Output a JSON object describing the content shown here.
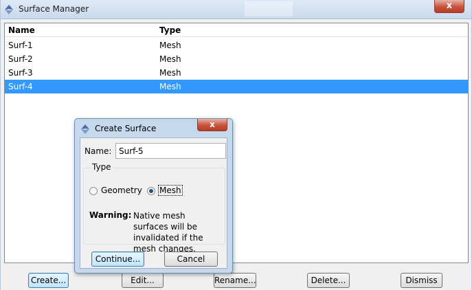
{
  "window": {
    "title": "Surface Manager",
    "close_glyph": "x"
  },
  "list": {
    "columns": [
      "Name",
      "Type"
    ],
    "rows": [
      {
        "name": "Surf-1",
        "type": "Mesh"
      },
      {
        "name": "Surf-2",
        "type": "Mesh"
      },
      {
        "name": "Surf-3",
        "type": "Mesh"
      },
      {
        "name": "Surf-4",
        "type": "Mesh"
      }
    ],
    "selected_row": "Surf-4"
  },
  "buttons": {
    "create": "Create...",
    "edit": "Edit...",
    "rename": "Rename...",
    "delete": "Delete...",
    "dismiss": "Dismiss"
  },
  "dialog": {
    "title": "Create Surface",
    "close_glyph": "x",
    "name_label": "Name:",
    "name_value": "Surf-5",
    "type_group_label": "Type",
    "options": [
      "Geometry",
      "Mesh"
    ],
    "selected_option": "Mesh",
    "warning_label": "Warning:",
    "warning_text": "Native mesh surfaces will be invalidated if the mesh changes.",
    "continue_label": "Continue...",
    "cancel_label": "Cancel"
  },
  "colors": {
    "selection": "#3399ff",
    "close_button": "#c9523c",
    "dialog_frame": "#c6d8ec"
  }
}
